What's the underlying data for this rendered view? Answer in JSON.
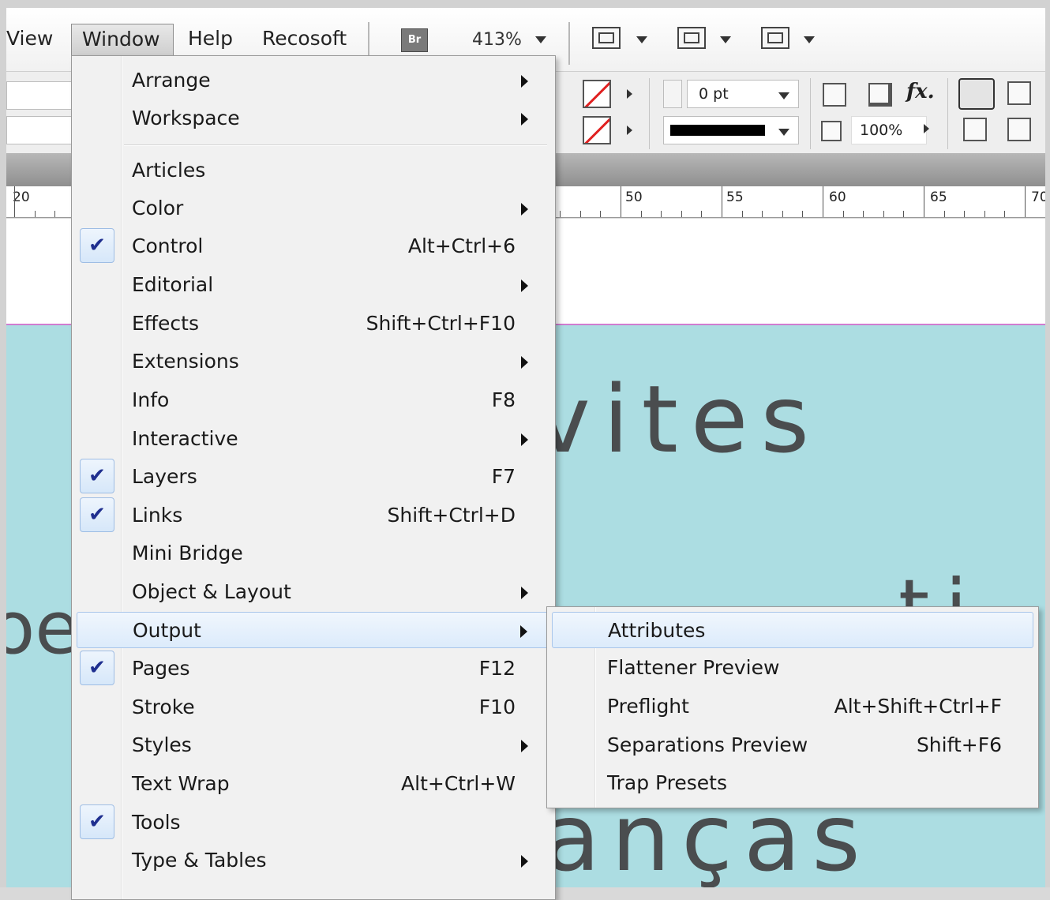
{
  "menubar": {
    "items": [
      "View",
      "Window",
      "Help",
      "Recosoft"
    ],
    "bridge_badge": "Br",
    "zoom": "413%"
  },
  "control_panel": {
    "stroke_weight": "0 pt",
    "opacity": "100%",
    "fx_label": "fx."
  },
  "ruler": {
    "labels": [
      "20",
      "50",
      "55",
      "60",
      "65",
      "70"
    ]
  },
  "canvas": {
    "word_vites": "vites",
    "word_ancas": "anças",
    "left_fragment": "oe",
    "right_fragment": "ti"
  },
  "window_menu": {
    "items": [
      {
        "label": "Arrange",
        "shortcut": "",
        "submenu": true,
        "checked": false
      },
      {
        "label": "Workspace",
        "shortcut": "",
        "submenu": true,
        "checked": false
      },
      {
        "label": "Articles",
        "shortcut": "",
        "submenu": false,
        "checked": false
      },
      {
        "label": "Color",
        "shortcut": "",
        "submenu": true,
        "checked": false
      },
      {
        "label": "Control",
        "shortcut": "Alt+Ctrl+6",
        "submenu": false,
        "checked": true
      },
      {
        "label": "Editorial",
        "shortcut": "",
        "submenu": true,
        "checked": false
      },
      {
        "label": "Effects",
        "shortcut": "Shift+Ctrl+F10",
        "submenu": false,
        "checked": false
      },
      {
        "label": "Extensions",
        "shortcut": "",
        "submenu": true,
        "checked": false
      },
      {
        "label": "Info",
        "shortcut": "F8",
        "submenu": false,
        "checked": false
      },
      {
        "label": "Interactive",
        "shortcut": "",
        "submenu": true,
        "checked": false
      },
      {
        "label": "Layers",
        "shortcut": "F7",
        "submenu": false,
        "checked": true
      },
      {
        "label": "Links",
        "shortcut": "Shift+Ctrl+D",
        "submenu": false,
        "checked": true
      },
      {
        "label": "Mini Bridge",
        "shortcut": "",
        "submenu": false,
        "checked": false
      },
      {
        "label": "Object & Layout",
        "shortcut": "",
        "submenu": true,
        "checked": false
      },
      {
        "label": "Output",
        "shortcut": "",
        "submenu": true,
        "checked": false
      },
      {
        "label": "Pages",
        "shortcut": "F12",
        "submenu": false,
        "checked": true
      },
      {
        "label": "Stroke",
        "shortcut": "F10",
        "submenu": false,
        "checked": false
      },
      {
        "label": "Styles",
        "shortcut": "",
        "submenu": true,
        "checked": false
      },
      {
        "label": "Text Wrap",
        "shortcut": "Alt+Ctrl+W",
        "submenu": false,
        "checked": false
      },
      {
        "label": "Tools",
        "shortcut": "",
        "submenu": false,
        "checked": true
      },
      {
        "label": "Type & Tables",
        "shortcut": "",
        "submenu": true,
        "checked": false
      }
    ]
  },
  "output_submenu": {
    "items": [
      {
        "label": "Attributes",
        "shortcut": ""
      },
      {
        "label": "Flattener Preview",
        "shortcut": ""
      },
      {
        "label": "Preflight",
        "shortcut": "Alt+Shift+Ctrl+F"
      },
      {
        "label": "Separations Preview",
        "shortcut": "Shift+F6"
      },
      {
        "label": "Trap Presets",
        "shortcut": ""
      }
    ]
  }
}
